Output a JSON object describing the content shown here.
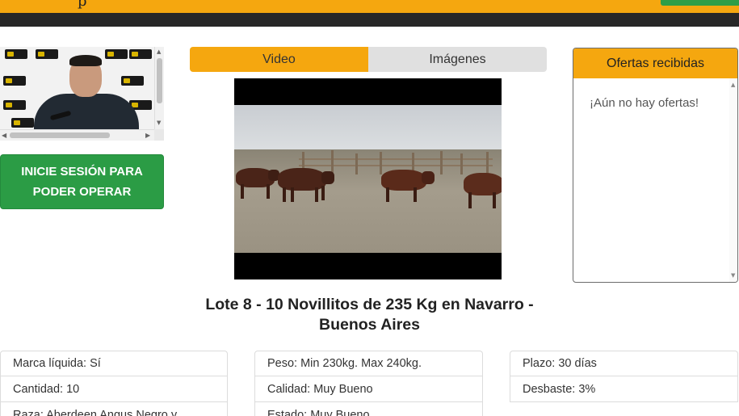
{
  "header": {
    "brand_fragment": "p"
  },
  "stream": {
    "logo_text": "",
    "scroll_up": "▲",
    "scroll_down": "▼",
    "scroll_left": "◀",
    "scroll_right": "▶"
  },
  "login_button": {
    "label": "INICIE SESIÓN PARA PODER OPERAR",
    "color": "#2b9c45"
  },
  "media_tabs": [
    {
      "label": "Video",
      "active": true
    },
    {
      "label": "Imágenes",
      "active": false
    }
  ],
  "offers": {
    "title": "Ofertas recibidas",
    "empty_message": "¡Aún no hay ofertas!",
    "scroll_up": "▲",
    "scroll_down": "▼"
  },
  "lot": {
    "title": "Lote 8 - 10 Novillitos de 235 Kg en Navarro - Buenos Aires"
  },
  "details": {
    "col1": [
      "Marca líquida: Sí",
      "Cantidad: 10",
      "Raza: Aberdeen Angus Negro y"
    ],
    "col2": [
      "Peso: Min 230kg. Max 240kg.",
      "Calidad: Muy Bueno",
      "Estado: Muy Bueno"
    ],
    "col3": [
      "Plazo: 30 días",
      "Desbaste: 3%"
    ]
  },
  "colors": {
    "accent": "#f5a70f",
    "dark_bar": "#272727",
    "success": "#2b9c45"
  }
}
